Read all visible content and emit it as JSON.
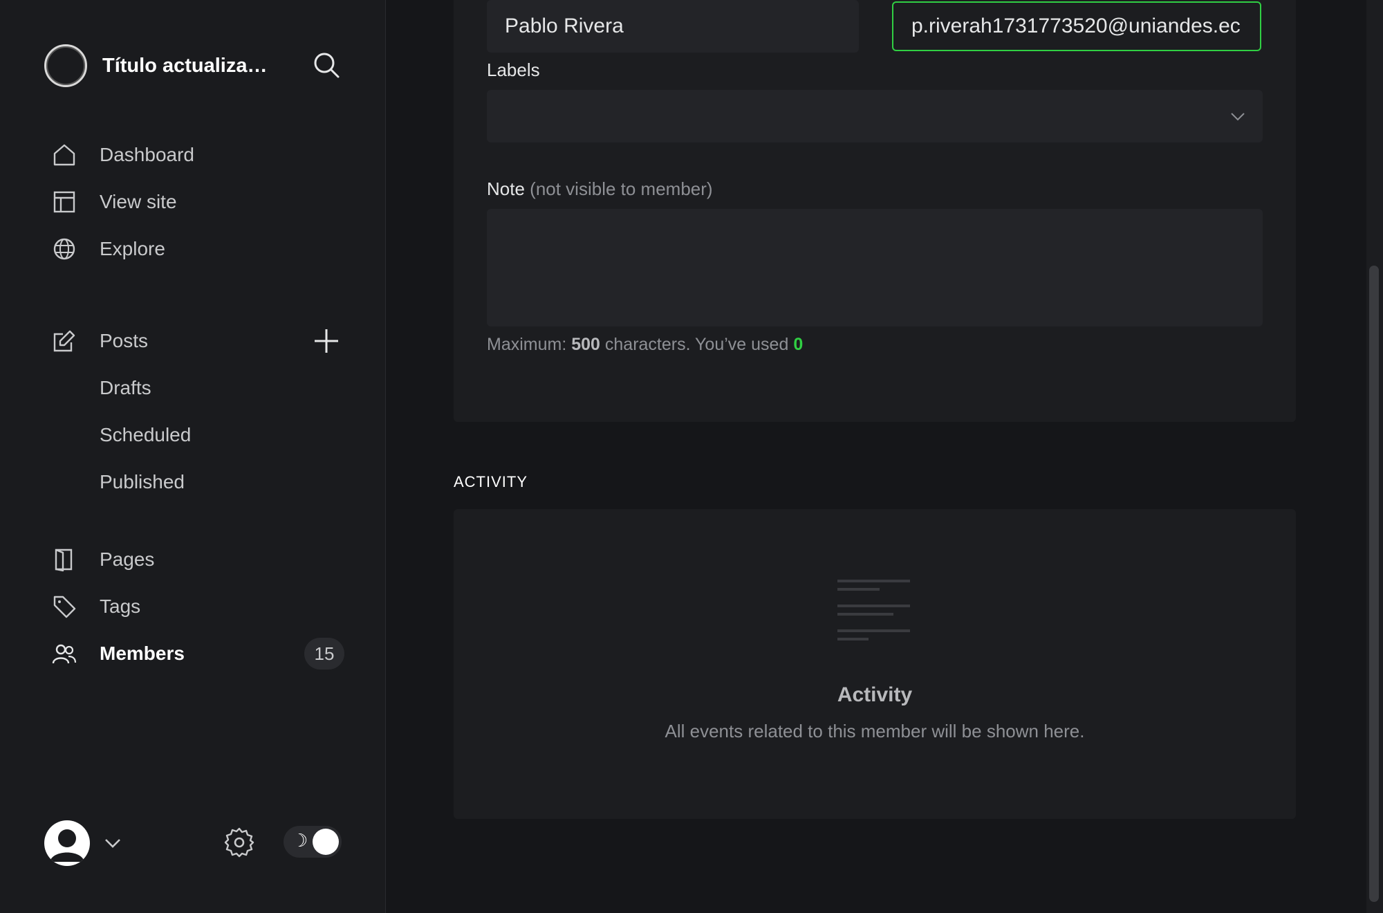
{
  "sidebar": {
    "site_title": "Título actualiza…",
    "nav": [
      {
        "label": "Dashboard",
        "icon": "home-icon"
      },
      {
        "label": "View site",
        "icon": "layout-icon"
      },
      {
        "label": "Explore",
        "icon": "globe-icon"
      }
    ],
    "posts": {
      "label": "Posts",
      "icon": "edit-icon",
      "subitems": [
        "Drafts",
        "Scheduled",
        "Published"
      ]
    },
    "content": [
      {
        "label": "Pages",
        "icon": "page-icon"
      },
      {
        "label": "Tags",
        "icon": "tag-icon"
      },
      {
        "label": "Members",
        "icon": "members-icon",
        "count": "15"
      }
    ]
  },
  "form": {
    "name_value": "Pablo Rivera",
    "email_value": "p.riverah1731773520@uniandes.ec",
    "labels_label": "Labels",
    "note_label": "Note",
    "note_sub": "(not visible to member)",
    "hint_prefix": "Maximum: ",
    "hint_max": "500",
    "hint_mid": " characters. You’ve used ",
    "hint_used": "0"
  },
  "activity": {
    "section_title": "ACTIVITY",
    "empty_title": "Activity",
    "empty_desc": "All events related to this member will be shown here."
  },
  "colors": {
    "accent": "#30cf43",
    "bg": "#151619",
    "card": "#1c1d20"
  }
}
